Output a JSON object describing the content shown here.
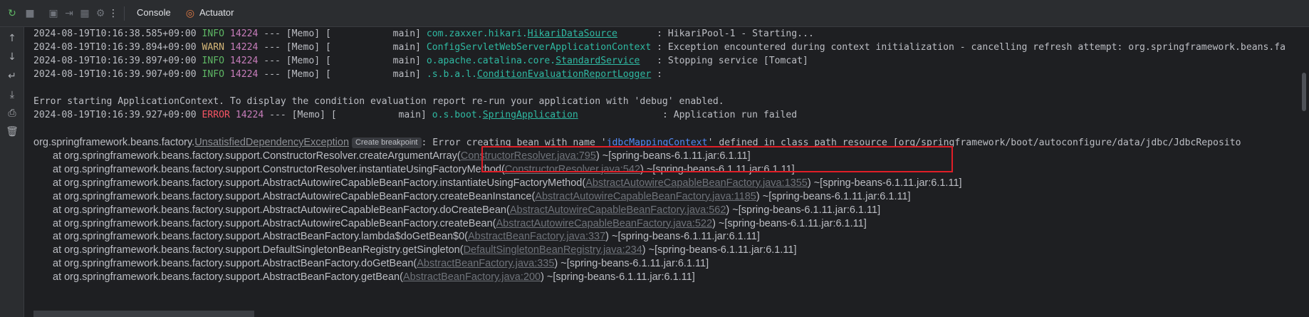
{
  "toolbar": {
    "tabs": [
      {
        "label": "Console",
        "icon": ""
      },
      {
        "label": "Actuator",
        "icon": "actuator-icon"
      }
    ]
  },
  "log_lines": [
    {
      "timestamp": "2024-08-19T10:16:38.585+09:00",
      "level": "INFO",
      "pid": "14224",
      "sep": " --- [Memo] [           main] ",
      "logger_prefix": "com.zaxxer.hikari.",
      "logger_class": "HikariDataSource",
      "pad": "       ",
      "message": ": HikariPool-1 - Starting..."
    },
    {
      "timestamp": "2024-08-19T10:16:39.894+09:00",
      "level": "WARN",
      "pid": "14224",
      "sep": " --- [Memo] [           main] ",
      "logger_prefix": "",
      "logger_class": "ConfigServletWebServerApplicationContext",
      "pad": " ",
      "message": ": Exception encountered during context initialization - cancelling refresh attempt: org.springframework.beans.fa"
    },
    {
      "timestamp": "2024-08-19T10:16:39.897+09:00",
      "level": "INFO",
      "pid": "14224",
      "sep": " --- [Memo] [           main] ",
      "logger_prefix": "o.apache.catalina.core.",
      "logger_class": "StandardService",
      "pad": "   ",
      "message": ": Stopping service [Tomcat]"
    },
    {
      "timestamp": "2024-08-19T10:16:39.907+09:00",
      "level": "INFO",
      "pid": "14224",
      "sep": " --- [Memo] [           main] ",
      "logger_prefix": ".s.b.a.l.",
      "logger_class": "ConditionEvaluationReportLogger",
      "pad": " ",
      "message": ":"
    }
  ],
  "error_context_line": "Error starting ApplicationContext. To display the condition evaluation report re-run your application with 'debug' enabled.",
  "error_line": {
    "timestamp": "2024-08-19T10:16:39.927+09:00",
    "level": "ERROR",
    "pid": "14224",
    "sep": " --- [Memo] [           main] ",
    "logger_prefix": "o.s.boot.",
    "logger_class": "SpringApplication",
    "pad": "               ",
    "message": ": Application run failed"
  },
  "exception": {
    "package": "org.springframework.beans.factory.",
    "class": "UnsatisfiedDependencyException",
    "breakpoint_label": "Create breakpoint",
    "msg_prefix": ": Error creating bean with name '",
    "bean_name": "jdbcMappingContext",
    "msg_suffix": "' defined in class path resource ",
    "resource": "[org/springframework/boot/autoconfigure/data/jdbc/JdbcReposito"
  },
  "stack_trace": [
    {
      "method": "at org.springframework.beans.factory.support.ConstructorResolver.createArgumentArray(",
      "source": "ConstructorResolver.java:795",
      "jar": ") ~[spring-beans-6.1.11.jar:6.1.11]"
    },
    {
      "method": "at org.springframework.beans.factory.support.ConstructorResolver.instantiateUsingFactoryMethod(",
      "source": "ConstructorResolver.java:542",
      "jar": ") ~[spring-beans-6.1.11.jar:6.1.11]"
    },
    {
      "method": "at org.springframework.beans.factory.support.AbstractAutowireCapableBeanFactory.instantiateUsingFactoryMethod(",
      "source": "AbstractAutowireCapableBeanFactory.java:1355",
      "jar": ") ~[spring-beans-6.1.11.jar:6.1.11]"
    },
    {
      "method": "at org.springframework.beans.factory.support.AbstractAutowireCapableBeanFactory.createBeanInstance(",
      "source": "AbstractAutowireCapableBeanFactory.java:1185",
      "jar": ") ~[spring-beans-6.1.11.jar:6.1.11]"
    },
    {
      "method": "at org.springframework.beans.factory.support.AbstractAutowireCapableBeanFactory.doCreateBean(",
      "source": "AbstractAutowireCapableBeanFactory.java:562",
      "jar": ") ~[spring-beans-6.1.11.jar:6.1.11]"
    },
    {
      "method": "at org.springframework.beans.factory.support.AbstractAutowireCapableBeanFactory.createBean(",
      "source": "AbstractAutowireCapableBeanFactory.java:522",
      "jar": ") ~[spring-beans-6.1.11.jar:6.1.11]"
    },
    {
      "method": "at org.springframework.beans.factory.support.AbstractBeanFactory.lambda$doGetBean$0(",
      "source": "AbstractBeanFactory.java:337",
      "jar": ") ~[spring-beans-6.1.11.jar:6.1.11]"
    },
    {
      "method": "at org.springframework.beans.factory.support.DefaultSingletonBeanRegistry.getSingleton(",
      "source": "DefaultSingletonBeanRegistry.java:234",
      "jar": ") ~[spring-beans-6.1.11.jar:6.1.11]"
    },
    {
      "method": "at org.springframework.beans.factory.support.AbstractBeanFactory.doGetBean(",
      "source": "AbstractBeanFactory.java:335",
      "jar": ") ~[spring-beans-6.1.11.jar:6.1.11]"
    },
    {
      "method": "at org.springframework.beans.factory.support.AbstractBeanFactory.getBean(",
      "source": "AbstractBeanFactory.java:200",
      "jar": ") ~[spring-beans-6.1.11.jar:6.1.11]"
    }
  ],
  "colors": {
    "info": "#5fb865",
    "warn": "#d5b778",
    "error": "#f75464",
    "logger": "#2fbaa3",
    "link": "#548af7",
    "highlight_box": "#e01e27"
  }
}
